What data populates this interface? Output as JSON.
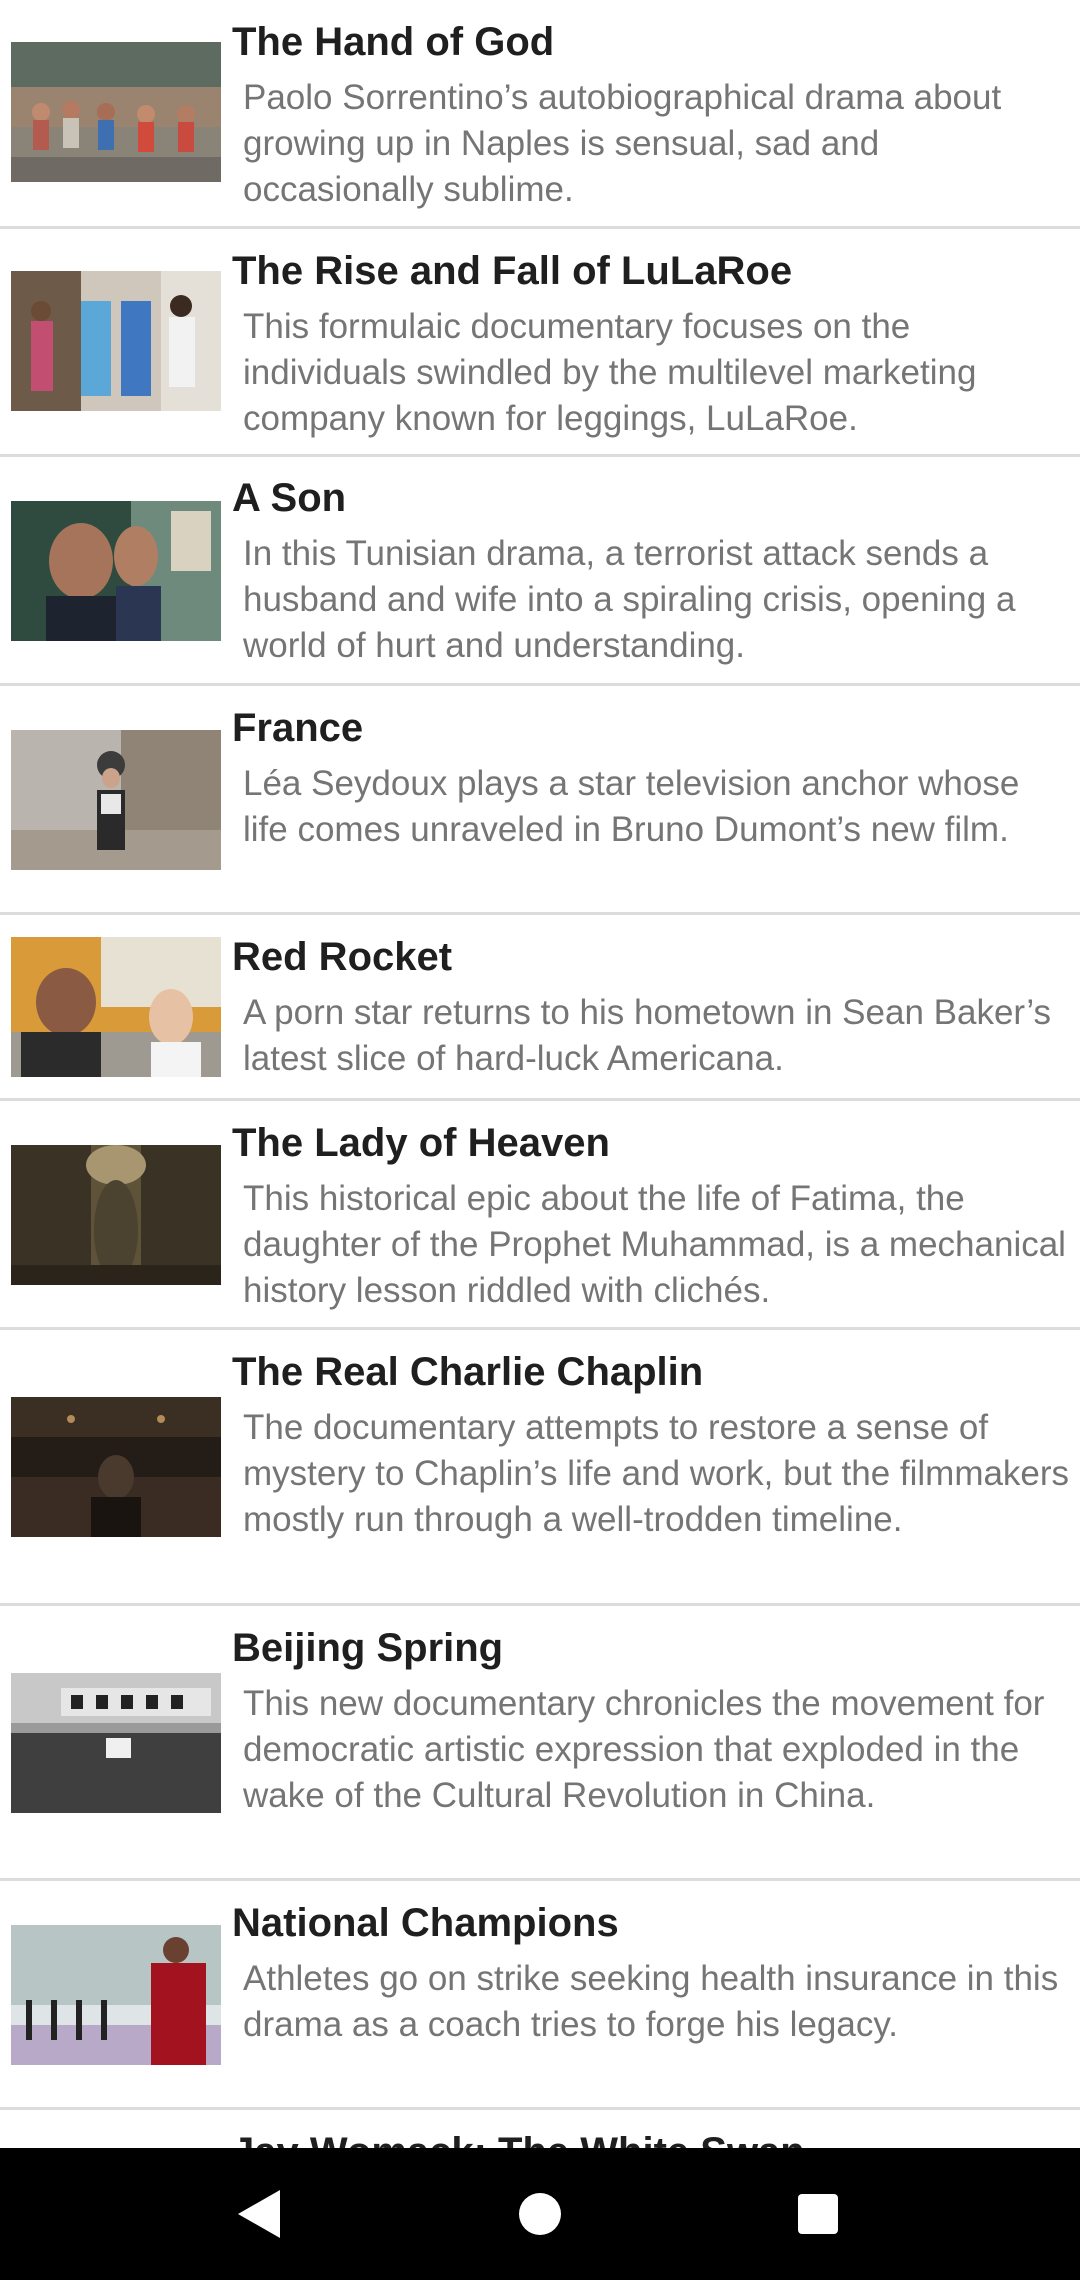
{
  "items": [
    {
      "title": "The Hand of God",
      "description": "Paolo Sorrentino’s autobiographical drama about growing up in Naples is sensual, sad and occasionally sublime."
    },
    {
      "title": "The Rise and Fall of LuLaRoe",
      "description": "This formulaic documentary focuses on the individuals swindled by the multilevel marketing company known for leggings, LuLaRoe."
    },
    {
      "title": "A Son",
      "description": "In this Tunisian drama, a terrorist attack sends a husband and wife into a spiraling crisis, opening a world of hurt and understanding."
    },
    {
      "title": "France",
      "description": "Léa Seydoux plays a star television anchor whose life comes unraveled in Bruno Dumont’s new film."
    },
    {
      "title": "Red Rocket",
      "description": "A porn star returns to his hometown in Sean Baker’s latest slice of hard-luck Americana."
    },
    {
      "title": "The Lady of Heaven",
      "description": "This historical epic about the life of Fatima, the daughter of the Prophet Muhammad, is a mechanical history lesson riddled with clichés."
    },
    {
      "title": "The Real Charlie Chaplin",
      "description": "The documentary attempts to restore a sense of mystery to Chaplin’s life and work, but the filmmakers mostly run through a well-trodden timeline."
    },
    {
      "title": "Beijing Spring",
      "description": "This new documentary chronicles the movement for democratic artistic expression that exploded in the wake of the Cultural Revolution in China."
    },
    {
      "title": "National Champions",
      "description": "Athletes go on strike seeking health insurance in this drama as a coach tries to forge his legacy."
    },
    {
      "title": "Jay Womack: The White Swan",
      "description": ""
    }
  ],
  "navbar": {
    "back_icon": "back-triangle-icon",
    "home_icon": "home-circle-icon",
    "recents_icon": "recents-square-icon"
  }
}
